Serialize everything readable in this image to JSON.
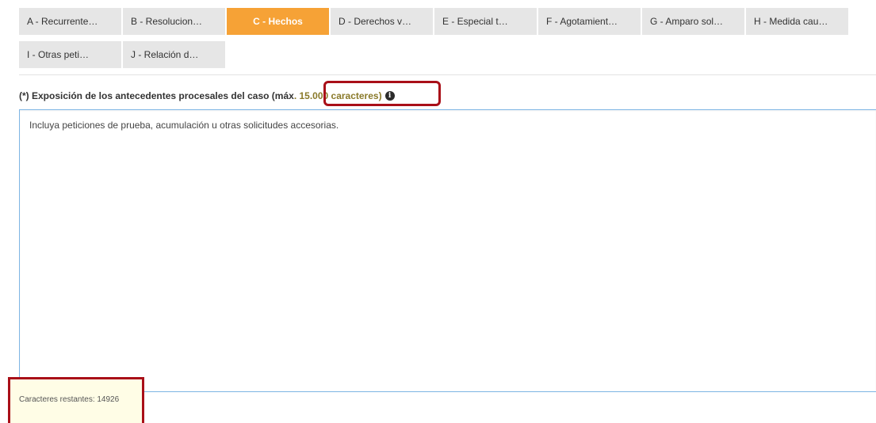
{
  "tabs": {
    "row1": [
      {
        "label": "A - Recurrente…",
        "active": false
      },
      {
        "label": "B - Resolucion…",
        "active": false
      },
      {
        "label": "C - Hechos",
        "active": true
      },
      {
        "label": "D - Derechos v…",
        "active": false
      },
      {
        "label": "E - Especial t…",
        "active": false
      },
      {
        "label": "F - Agotamient…",
        "active": false
      },
      {
        "label": "G - Amparo sol…",
        "active": false
      },
      {
        "label": "H - Medida cau…",
        "active": false
      }
    ],
    "row2": [
      {
        "label": "I - Otras peti…",
        "active": false
      },
      {
        "label": "J - Relación d…",
        "active": false
      }
    ]
  },
  "field": {
    "label_prefix": "(*) Exposición de los antecedentes procesales del caso (máx",
    "label_max": ". 15.000 caracteres)",
    "info_icon": "info-icon",
    "textarea_value": "Incluya peticiones de prueba, acumulación u otras solicitudes accesorias.",
    "counter_label": "Caracteres restantes: 14926"
  },
  "colors": {
    "active_tab": "#f6a236",
    "inactive_tab": "#e6e6e6",
    "highlight_border": "#a90f18",
    "textarea_border": "#7db5e4"
  }
}
